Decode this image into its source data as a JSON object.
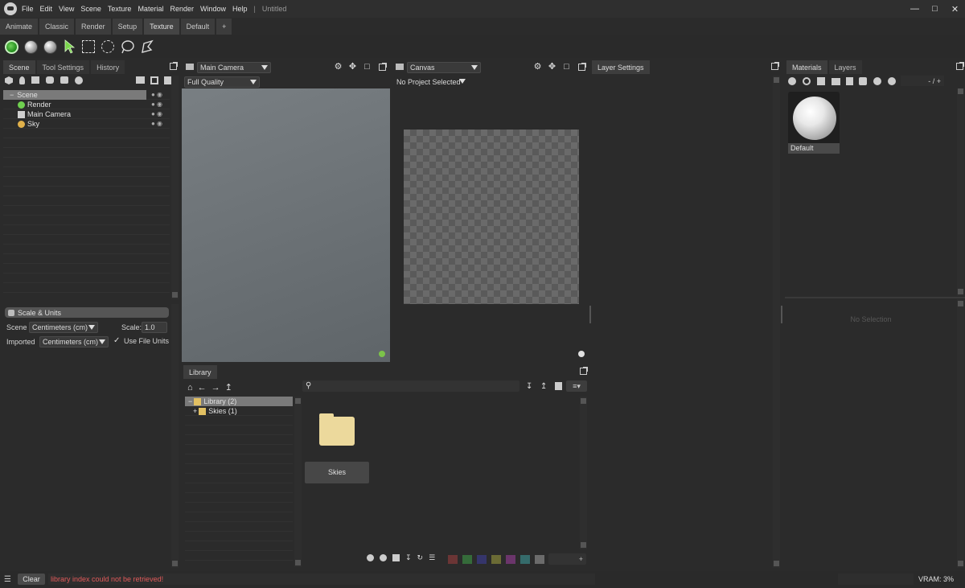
{
  "menubar": {
    "items": [
      "File",
      "Edit",
      "View",
      "Scene",
      "Texture",
      "Material",
      "Render",
      "Window",
      "Help"
    ],
    "separator": "|",
    "document_title": "Untitled"
  },
  "workspace_tabs": [
    "Animate",
    "Classic",
    "Render",
    "Setup",
    "Texture",
    "Default",
    "+"
  ],
  "scene_panel": {
    "tabs": [
      "Scene",
      "Tool Settings",
      "History"
    ],
    "tree": [
      {
        "label": "Scene",
        "icon": "scene-icon"
      },
      {
        "label": "Render",
        "icon": "render-gear-icon"
      },
      {
        "label": "Main Camera",
        "icon": "camera-icon"
      },
      {
        "label": "Sky",
        "icon": "sky-icon"
      }
    ]
  },
  "scale_units": {
    "title": "Scale & Units",
    "scene_label": "Scene",
    "scene_value": "Centimeters (cm)",
    "scale_label": "Scale:",
    "scale_value": "1.0",
    "imported_label": "Imported",
    "imported_value": "Centimeters (cm)",
    "use_file_units_label": "Use File Units",
    "use_file_units_checked": true
  },
  "viewport": {
    "camera_select": "Main Camera",
    "quality_select": "Full Quality",
    "status_dot_color": "#7cc34a"
  },
  "canvas": {
    "title_select": "Canvas",
    "project_select": "No Project Selected"
  },
  "layer_settings": {
    "tab": "Layer Settings"
  },
  "materials_panel": {
    "tabs": [
      "Materials",
      "Layers"
    ],
    "counter": "- / +",
    "materials": [
      {
        "label": "Default"
      }
    ],
    "no_selection": "No Selection"
  },
  "library": {
    "tab": "Library",
    "tree": [
      {
        "label": "Library (2)"
      },
      {
        "label": "Skies (1)"
      }
    ],
    "items": [
      {
        "label": "Skies"
      }
    ],
    "color_filters": [
      "#6b3535",
      "#356b3a",
      "#35356b",
      "#6b6b35",
      "#6b356b",
      "#356b6b",
      "#6b6b6b"
    ],
    "size_control": "+"
  },
  "statusbar": {
    "clear_label": "Clear",
    "message": "library index could not be retrieved!",
    "message_color": "#e05a5a",
    "vram": "VRAM: 3%"
  }
}
